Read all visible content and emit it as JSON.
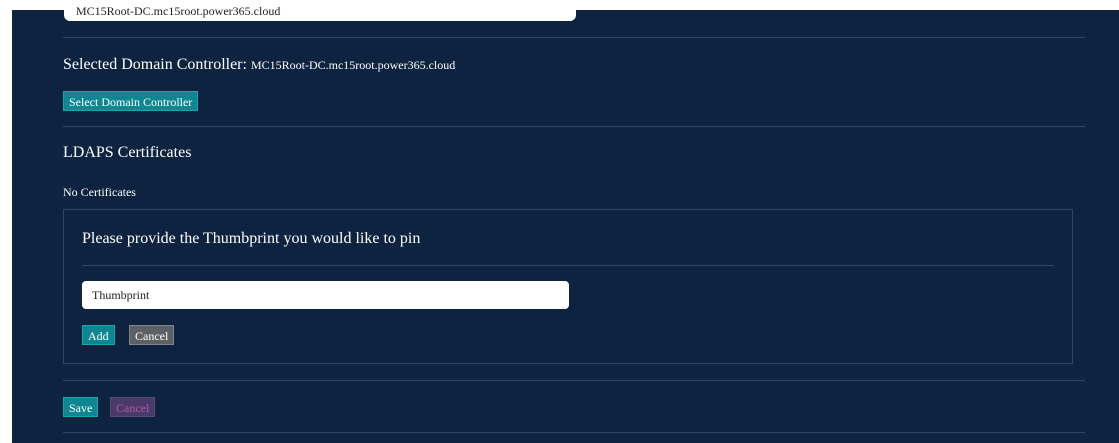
{
  "form": {
    "top_input_value": "MC15Root-DC.mc15root.power365.cloud",
    "selected_dc_label": "Selected Domain Controller:",
    "selected_dc_value": "MC15Root-DC.mc15root.power365.cloud",
    "select_dc_button": "Select Domain Controller",
    "ldaps_title": "LDAPS Certificates",
    "no_certs_text": "No Certificates",
    "pin_prompt": "Please provide the Thumbprint you would like to pin",
    "thumbprint_placeholder": "Thumbprint",
    "add_button": "Add",
    "inner_cancel_button": "Cancel",
    "save_button": "Save",
    "cancel_button": "Cancel"
  },
  "colors": {
    "panel_bg": "#0e2340",
    "teal_button": "#0f8792",
    "grey_button": "#5d6166",
    "cancel_text": "#b15aa4"
  }
}
